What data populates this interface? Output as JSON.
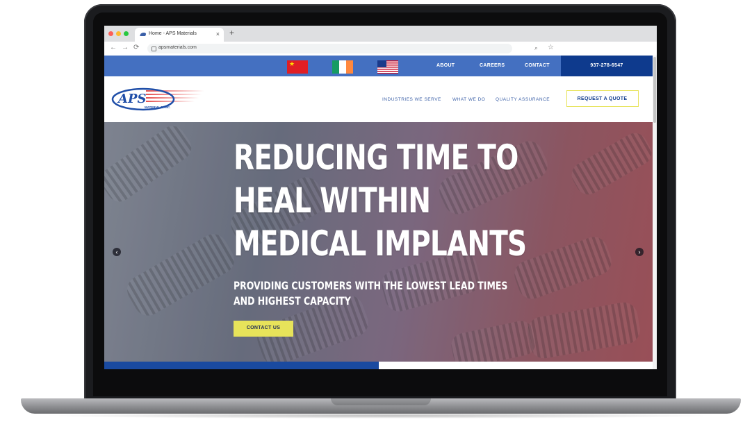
{
  "browser": {
    "tab_title": "Home - APS Materials",
    "tab_close": "×",
    "new_tab": "+",
    "back": "←",
    "forward": "→",
    "reload": "⟳",
    "url": "apsmaterials.com",
    "zoom_icon": "⌕",
    "bookmark_icon": "☆"
  },
  "topbar": {
    "flags": [
      "china-flag",
      "ireland-flag",
      "usa-flag"
    ],
    "links": [
      "ABOUT",
      "CAREERS",
      "CONTACT"
    ],
    "phone": "937-278-6547"
  },
  "header": {
    "logo_text": "APS",
    "logo_sub": "MATERIALS, INC.",
    "nav": [
      "INDUSTRIES WE SERVE",
      "WHAT WE DO",
      "QUALITY ASSURANCE"
    ],
    "quote_button": "REQUEST A QUOTE"
  },
  "hero": {
    "title_lines": [
      "REDUCING TIME TO",
      "HEAL WITHIN",
      "MEDICAL IMPLANTS"
    ],
    "subtitle_lines": [
      "PROVIDING CUSTOMERS WITH THE LOWEST LEAD TIMES",
      "AND HIGHEST CAPACITY"
    ],
    "cta": "CONTACT US",
    "prev_arrow": "‹",
    "next_arrow": "›"
  },
  "slider_progress": 0.5,
  "colors": {
    "topbar": "#4470c1",
    "phone_bg": "#0e3a8d",
    "accent_yellow": "#e7e35a",
    "nav_text": "#3e62a8",
    "progress_fill": "#1a4aa0"
  }
}
